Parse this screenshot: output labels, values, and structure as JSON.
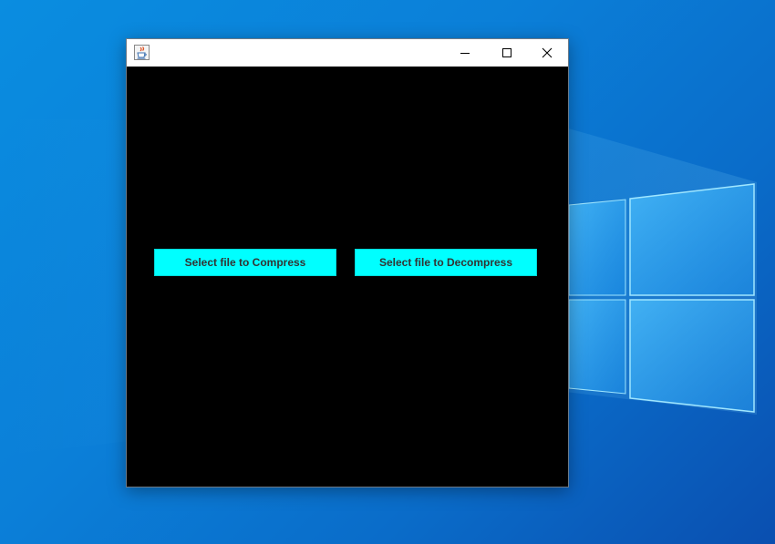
{
  "desktop": {
    "wallpaper_icon": "windows-logo-wallpaper",
    "accent_color": "#0b7fd8"
  },
  "window": {
    "title": "",
    "app_icon": "java-coffee-cup-icon",
    "controls": {
      "minimize_icon": "minimize-icon",
      "maximize_icon": "maximize-icon",
      "close_icon": "close-icon"
    },
    "background_color": "#000000"
  },
  "buttons": {
    "compress_label": "Select file to Compress",
    "decompress_label": "Select file to Decompress",
    "color": "#00ffff"
  }
}
